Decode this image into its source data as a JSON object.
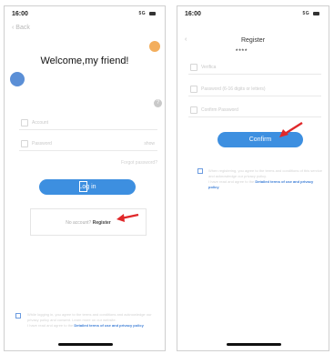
{
  "status_bar": {
    "time": "16:00",
    "signal": "5G"
  },
  "login": {
    "back_label": "Back",
    "welcome": "Welcome,my friend!",
    "help_icon": "question-icon",
    "account_placeholder": "Account",
    "password_placeholder": "Password",
    "password_toggle": "show",
    "forgot": "Forgot password?",
    "login_button": "Log in",
    "no_account": "No account?",
    "register_link": "Register",
    "agreement_prefix": "While logging in, you agree to the terms and conditions and acknowledge our privacy policy and consent. Learn more on our website.",
    "agreement_note": "I have read and agree to the",
    "agreement_link": "Detailed terms of use and privacy policy",
    "accent_color": "#3d8fe0"
  },
  "register": {
    "title": "Register",
    "masked_value": "****",
    "fields": [
      {
        "placeholder": "Verifica"
      },
      {
        "placeholder": "Password (6-16 digits or letters)"
      },
      {
        "placeholder": "Confirm Password"
      }
    ],
    "confirm_button": "Confirm",
    "agreement_text": "When registering, you agree to the terms and conditions of this service and acknowledge our privacy policy.",
    "agreement_note": "I have read and agree to the",
    "agreement_link": "Detailed terms of use and privacy policy"
  }
}
